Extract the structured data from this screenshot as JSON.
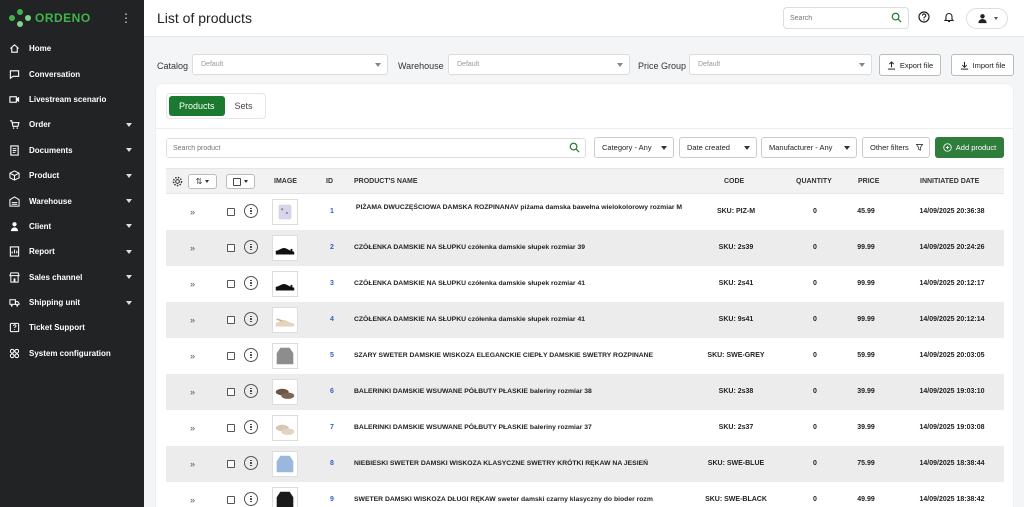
{
  "brand": {
    "name": "ORDENO"
  },
  "sidebar": {
    "items": [
      {
        "label": "Home",
        "icon": "home-icon",
        "chevron": false
      },
      {
        "label": "Conversation",
        "icon": "chat-icon",
        "chevron": false
      },
      {
        "label": "Livestream scenario",
        "icon": "video-icon",
        "chevron": false
      },
      {
        "label": "Order",
        "icon": "cart-icon",
        "chevron": true
      },
      {
        "label": "Documents",
        "icon": "document-icon",
        "chevron": true
      },
      {
        "label": "Product",
        "icon": "box-icon",
        "chevron": true
      },
      {
        "label": "Warehouse",
        "icon": "warehouse-icon",
        "chevron": true
      },
      {
        "label": "Client",
        "icon": "user-icon",
        "chevron": true
      },
      {
        "label": "Report",
        "icon": "report-icon",
        "chevron": true
      },
      {
        "label": "Sales channel",
        "icon": "store-icon",
        "chevron": true
      },
      {
        "label": "Shipping unit",
        "icon": "truck-icon",
        "chevron": true
      },
      {
        "label": "Ticket Support",
        "icon": "ticket-icon",
        "chevron": false
      },
      {
        "label": "System configuration",
        "icon": "grid-icon",
        "chevron": false
      }
    ]
  },
  "header": {
    "title": "List of products",
    "search_placeholder": "Search"
  },
  "filters": {
    "catalog_label": "Catalog",
    "catalog_value": "Default",
    "warehouse_label": "Warehouse",
    "warehouse_value": "Default",
    "price_group_label": "Price Group",
    "price_group_value": "Default",
    "export_label": "Export file",
    "import_label": "Import file"
  },
  "tabs": [
    {
      "label": "Products",
      "active": true
    },
    {
      "label": "Sets",
      "active": false
    }
  ],
  "toolbar": {
    "search_placeholder": "Search product",
    "category": "Category - Any",
    "date_created": "Date created",
    "manufacturer": "Manufacturer - Any",
    "other_filters": "Other filters",
    "add_product": "Add product"
  },
  "table": {
    "headers": {
      "image": "IMAGE",
      "id": "ID",
      "name": "PRODUCT'S NAME",
      "code": "CODE",
      "quantity": "QUANTITY",
      "price": "PRICE",
      "date": "INNITIATED DATE"
    },
    "rows": [
      {
        "id": "1",
        "name": "PIŻAMA DWUCZĘŚCIOWA DAMSKA ROZPINANAV piżama damska bawełna wielokolorowy rozmiar M",
        "code": "SKU: PIZ-M",
        "qty": "0",
        "price": "45.99",
        "date": "14/09/2025 20:36:38",
        "thumb": "pajama"
      },
      {
        "id": "2",
        "name": "CZÓŁENKA DAMSKIE NA SŁUPKU czółenka damskie słupek rozmiar 39",
        "code": "SKU: 2s39",
        "qty": "0",
        "price": "99.99",
        "date": "14/09/2025 20:24:26",
        "thumb": "shoe-black"
      },
      {
        "id": "3",
        "name": "CZÓŁENKA DAMSKIE NA SŁUPKU czółenka damskie słupek rozmiar 41",
        "code": "SKU: 2s41",
        "qty": "0",
        "price": "99.99",
        "date": "14/09/2025 20:12:17",
        "thumb": "shoe-black"
      },
      {
        "id": "4",
        "name": "CZÓŁENKA DAMSKIE NA SŁUPKU czółenka damskie słupek rozmiar 41",
        "code": "SKU: 9s41",
        "qty": "0",
        "price": "99.99",
        "date": "14/09/2025 20:12:14",
        "thumb": "shoe-beige"
      },
      {
        "id": "5",
        "name": "SZARY SWETER DAMSKIE WISKOZA ELEGANCKIE CIEPŁY DAMSKIE SWETRY ROZPINANE",
        "code": "SKU: SWE-GREY",
        "qty": "0",
        "price": "59.99",
        "date": "14/09/2025 20:03:05",
        "thumb": "sweater-grey"
      },
      {
        "id": "6",
        "name": "BALERINKI DAMSKIE WSUWANE PÓŁBUTY PŁASKIE baleriny rozmiar 38",
        "code": "SKU: 2s38",
        "qty": "0",
        "price": "39.99",
        "date": "14/09/2025 19:03:10",
        "thumb": "flats-brown"
      },
      {
        "id": "7",
        "name": "BALERINKI DAMSKIE WSUWANE PÓŁBUTY PŁASKIE baleriny rozmiar 37",
        "code": "SKU: 2s37",
        "qty": "0",
        "price": "39.99",
        "date": "14/09/2025 19:03:08",
        "thumb": "flats-beige"
      },
      {
        "id": "8",
        "name": "NIEBIESKI SWETER DAMSKI WISKOZA KLASYCZNE SWETRY KRÓTKI RĘKAW NA JESIEŃ",
        "code": "SKU: SWE-BLUE",
        "qty": "0",
        "price": "75.99",
        "date": "14/09/2025 18:38:44",
        "thumb": "sweater-blue"
      },
      {
        "id": "9",
        "name": "SWETER DAMSKI WISKOZA DŁUGI RĘKAW sweter damski czarny klasyczny do bioder rozm",
        "code": "SKU: SWE-BLACK",
        "qty": "0",
        "price": "49.99",
        "date": "14/09/2025 18:38:42",
        "thumb": "sweater-black"
      }
    ]
  },
  "colors": {
    "sidebar_bg": "#222325",
    "accent": "#1b7a2f",
    "id_link": "#2a63c8"
  }
}
